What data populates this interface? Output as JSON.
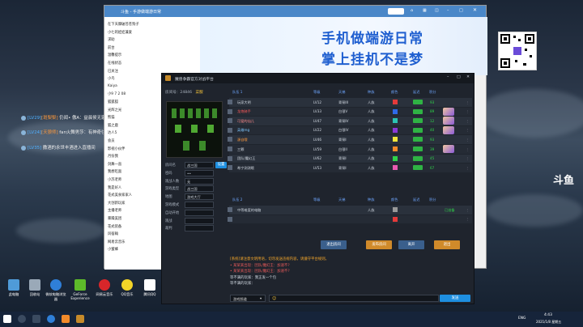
{
  "desktop": {
    "right_text": "斗鱼",
    "chat_lines": [
      {
        "level": "[LV29]",
        "name": "[斑梨梨]",
        "text": "仍闻• 傲A：益晨侯无家可归"
      },
      {
        "level": "[LV24]",
        "name": "[天狼师]",
        "text": "fan火舞男莎：有神奇往送永创吗"
      },
      {
        "level": "[LV35]",
        "name": "",
        "text": "撒酒的永世丰酒进入直播间"
      }
    ],
    "icons": [
      {
        "label": "此电脑"
      },
      {
        "label": "回收站"
      },
      {
        "label": "微软电脑浏览器"
      },
      {
        "label": "GeForce Experience"
      },
      {
        "label": "网易云音乐"
      },
      {
        "label": "QQ音乐"
      },
      {
        "label": "腾讯QQ"
      }
    ]
  },
  "browser": {
    "title": "斗鱼 - 手游做端游日常",
    "banner_line1": "手机做端游日常",
    "banner_line2": "掌上挂机不是梦",
    "sidebar_rows": [
      "在下天摩破苍苍狗子",
      "小七的娃娃兼爱",
      "求助",
      "前台",
      "温馨提示",
      "在线状态",
      "已关注",
      "小鸟",
      "Kaiya",
      "小9 7 2 08",
      "狐狐狐",
      "光辉之光",
      "熊猫",
      "狐之鹿",
      "达人5",
      "会员",
      "影视小伙伴",
      "月份我",
      "剑舞一直",
      "我想吃面",
      "小苏老师",
      "我是好人",
      "花式美食家家人",
      "大创新玩家",
      "主播老师",
      "暴躁美团",
      "花式装备",
      "风宿翰",
      "网易云音乐",
      "小蜜蜂"
    ]
  },
  "game": {
    "title": "魔兽争霸官方对战平台",
    "room_label": "房间号：",
    "room_number": "24846",
    "room_name": "菜服",
    "left_fields": [
      {
        "label": "房间名",
        "value": "战三国"
      },
      {
        "label": "密码",
        "value": "••"
      },
      {
        "label": "观战人数",
        "value": "无"
      },
      {
        "label": "游戏类型",
        "value": "战三国"
      },
      {
        "label": "地图",
        "value": "游戏大厅"
      },
      {
        "label": "游戏模式",
        "value": ""
      },
      {
        "label": "自动开始",
        "value": ""
      },
      {
        "label": "观战",
        "value": ""
      },
      {
        "label": "裁判",
        "value": ""
      }
    ],
    "left_extra_button": "设置",
    "team1_label": "队伍 1",
    "team2_label": "队伍 2",
    "columns": [
      "等级",
      "天梯",
      "种族",
      "颜色",
      "延迟",
      "积分"
    ],
    "team1": [
      {
        "name": "玩家大明",
        "lvl": "LV12",
        "ladder": "青铜III",
        "race": "人族",
        "color": "#e53a3a",
        "score": "93",
        "hero": false
      },
      {
        "name": "龙炮骑手",
        "lvl": "LV33",
        "ladder": "白银V",
        "race": "人族",
        "color": "#2f6ae8",
        "score": "89",
        "hero": true
      },
      {
        "name": "可爱的仙儿",
        "lvl": "LV47",
        "ladder": "青铜IV",
        "race": "人族",
        "color": "#2bc4b4",
        "score": "12",
        "hero": true
      },
      {
        "name": "英雄mg",
        "lvl": "LV22",
        "ladder": "白银IV",
        "race": "人族",
        "color": "#8a3ad8",
        "score": "40",
        "hero": true
      },
      {
        "name": "源自哦",
        "lvl": "LV46",
        "ladder": "青铜I",
        "race": "人族",
        "color": "#f2e63a",
        "score": "93",
        "hero": false
      },
      {
        "name": "三颗",
        "lvl": "LV59",
        "ladder": "白银II",
        "race": "人族",
        "color": "#f28a2a",
        "score": "39",
        "hero": true
      },
      {
        "name": "团队/魔幻王",
        "lvl": "LV62",
        "ladder": "青铜I",
        "race": "人族",
        "color": "#2fd34a",
        "score": "45",
        "hero": false
      },
      {
        "name": "希宁测测哦",
        "lvl": "LV53",
        "ladder": "青铜I",
        "race": "人族",
        "color": "#e85ab0",
        "score": "67",
        "hero": false
      }
    ],
    "team2": [
      {
        "name": "中等难度的电脑",
        "lvl": "",
        "ladder": "",
        "race": "人族",
        "color": "#999999",
        "score": "",
        "status": "已准备"
      },
      {
        "name": "",
        "lvl": "",
        "ladder": "",
        "race": "",
        "color": "#e53a3a",
        "score": "",
        "status": ""
      }
    ],
    "actions": [
      "退出房间",
      "发布房间",
      "离开",
      "退出"
    ],
    "log": [
      "[系统]请注意文明用语，切勿发送违规内容，请遵守平台规则。",
      "• 某某某出现：团队/魔幻王：加速不?",
      "• 某某某出现：团队/魔幻王：加速不?",
      "等不满的玩家：我正发一个包",
      "等不满的玩家："
    ],
    "input_placeholder": "游戏频道",
    "send_label": "发送"
  },
  "taskbar": {
    "time": "4:43",
    "date": "2021/1/8 星期五",
    "lang": "ENG"
  }
}
